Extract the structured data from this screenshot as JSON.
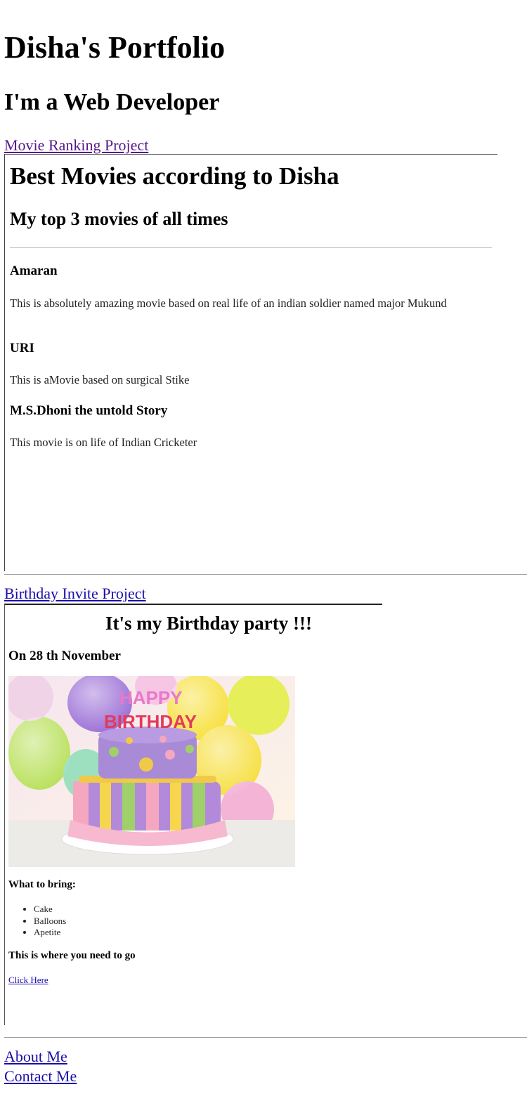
{
  "header": {
    "title": "Disha's Portfolio",
    "subtitle": "I'm a Web Developer"
  },
  "projects": {
    "movie_link": "Movie Ranking Project",
    "birthday_link": "Birthday Invite Project"
  },
  "movie_page": {
    "title": "Best Movies according to Disha",
    "subtitle": "My top 3 movies of all times",
    "movies": [
      {
        "name": "Amaran",
        "description": "This is absolutely amazing movie based on real life of an indian soldier named major Mukund"
      },
      {
        "name": "URI",
        "description": "This is aMovie based on surgical Stike"
      },
      {
        "name": "M.S.Dhoni the untold Story",
        "description": "This movie is on life of Indian Cricketer"
      }
    ]
  },
  "birthday_page": {
    "title": "It's my Birthday party !!!",
    "date": "On 28 th November",
    "image_text": [
      "HAPPY",
      "BIRTHDAY"
    ],
    "bring_heading": "What to bring:",
    "bring_items": [
      "Cake",
      "Balloons",
      "Apetite"
    ],
    "location_heading": "This is where you need to go",
    "location_link": "Click Here"
  },
  "footer": {
    "about": "About Me",
    "contact": "Contact Me"
  }
}
